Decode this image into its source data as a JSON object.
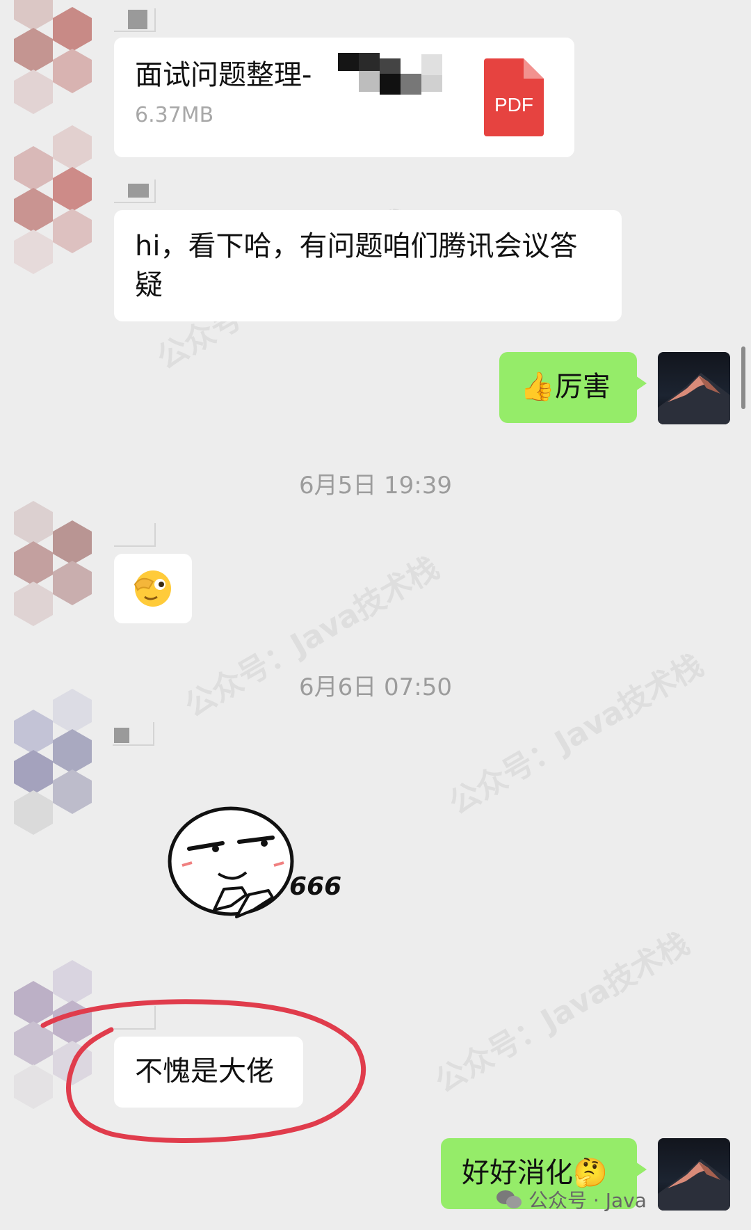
{
  "messages": {
    "file": {
      "title": "面试问题整理-",
      "size": "6.37MB",
      "badge": "PDF"
    },
    "msg_hi": {
      "line1": "hi，看下哈，有问题咱们腾讯会议答",
      "line2": "疑"
    },
    "reply_great": {
      "emoji": "👍",
      "text": "厉害"
    },
    "time1": "6月5日 19:39",
    "time2": "6月6日 07:50",
    "sticker": {
      "text": "666"
    },
    "msg_boss": "不愧是大佬",
    "reply_digest": {
      "text": "好好消化",
      "emoji": "🤔"
    }
  },
  "watermark": {
    "footer": "公众号 · Java"
  },
  "colors": {
    "background": "#ededed",
    "bubble_mine": "#95ec69",
    "bubble_other": "#ffffff",
    "pdf_red": "#e64340",
    "highlight_circle": "#e03c4c"
  }
}
